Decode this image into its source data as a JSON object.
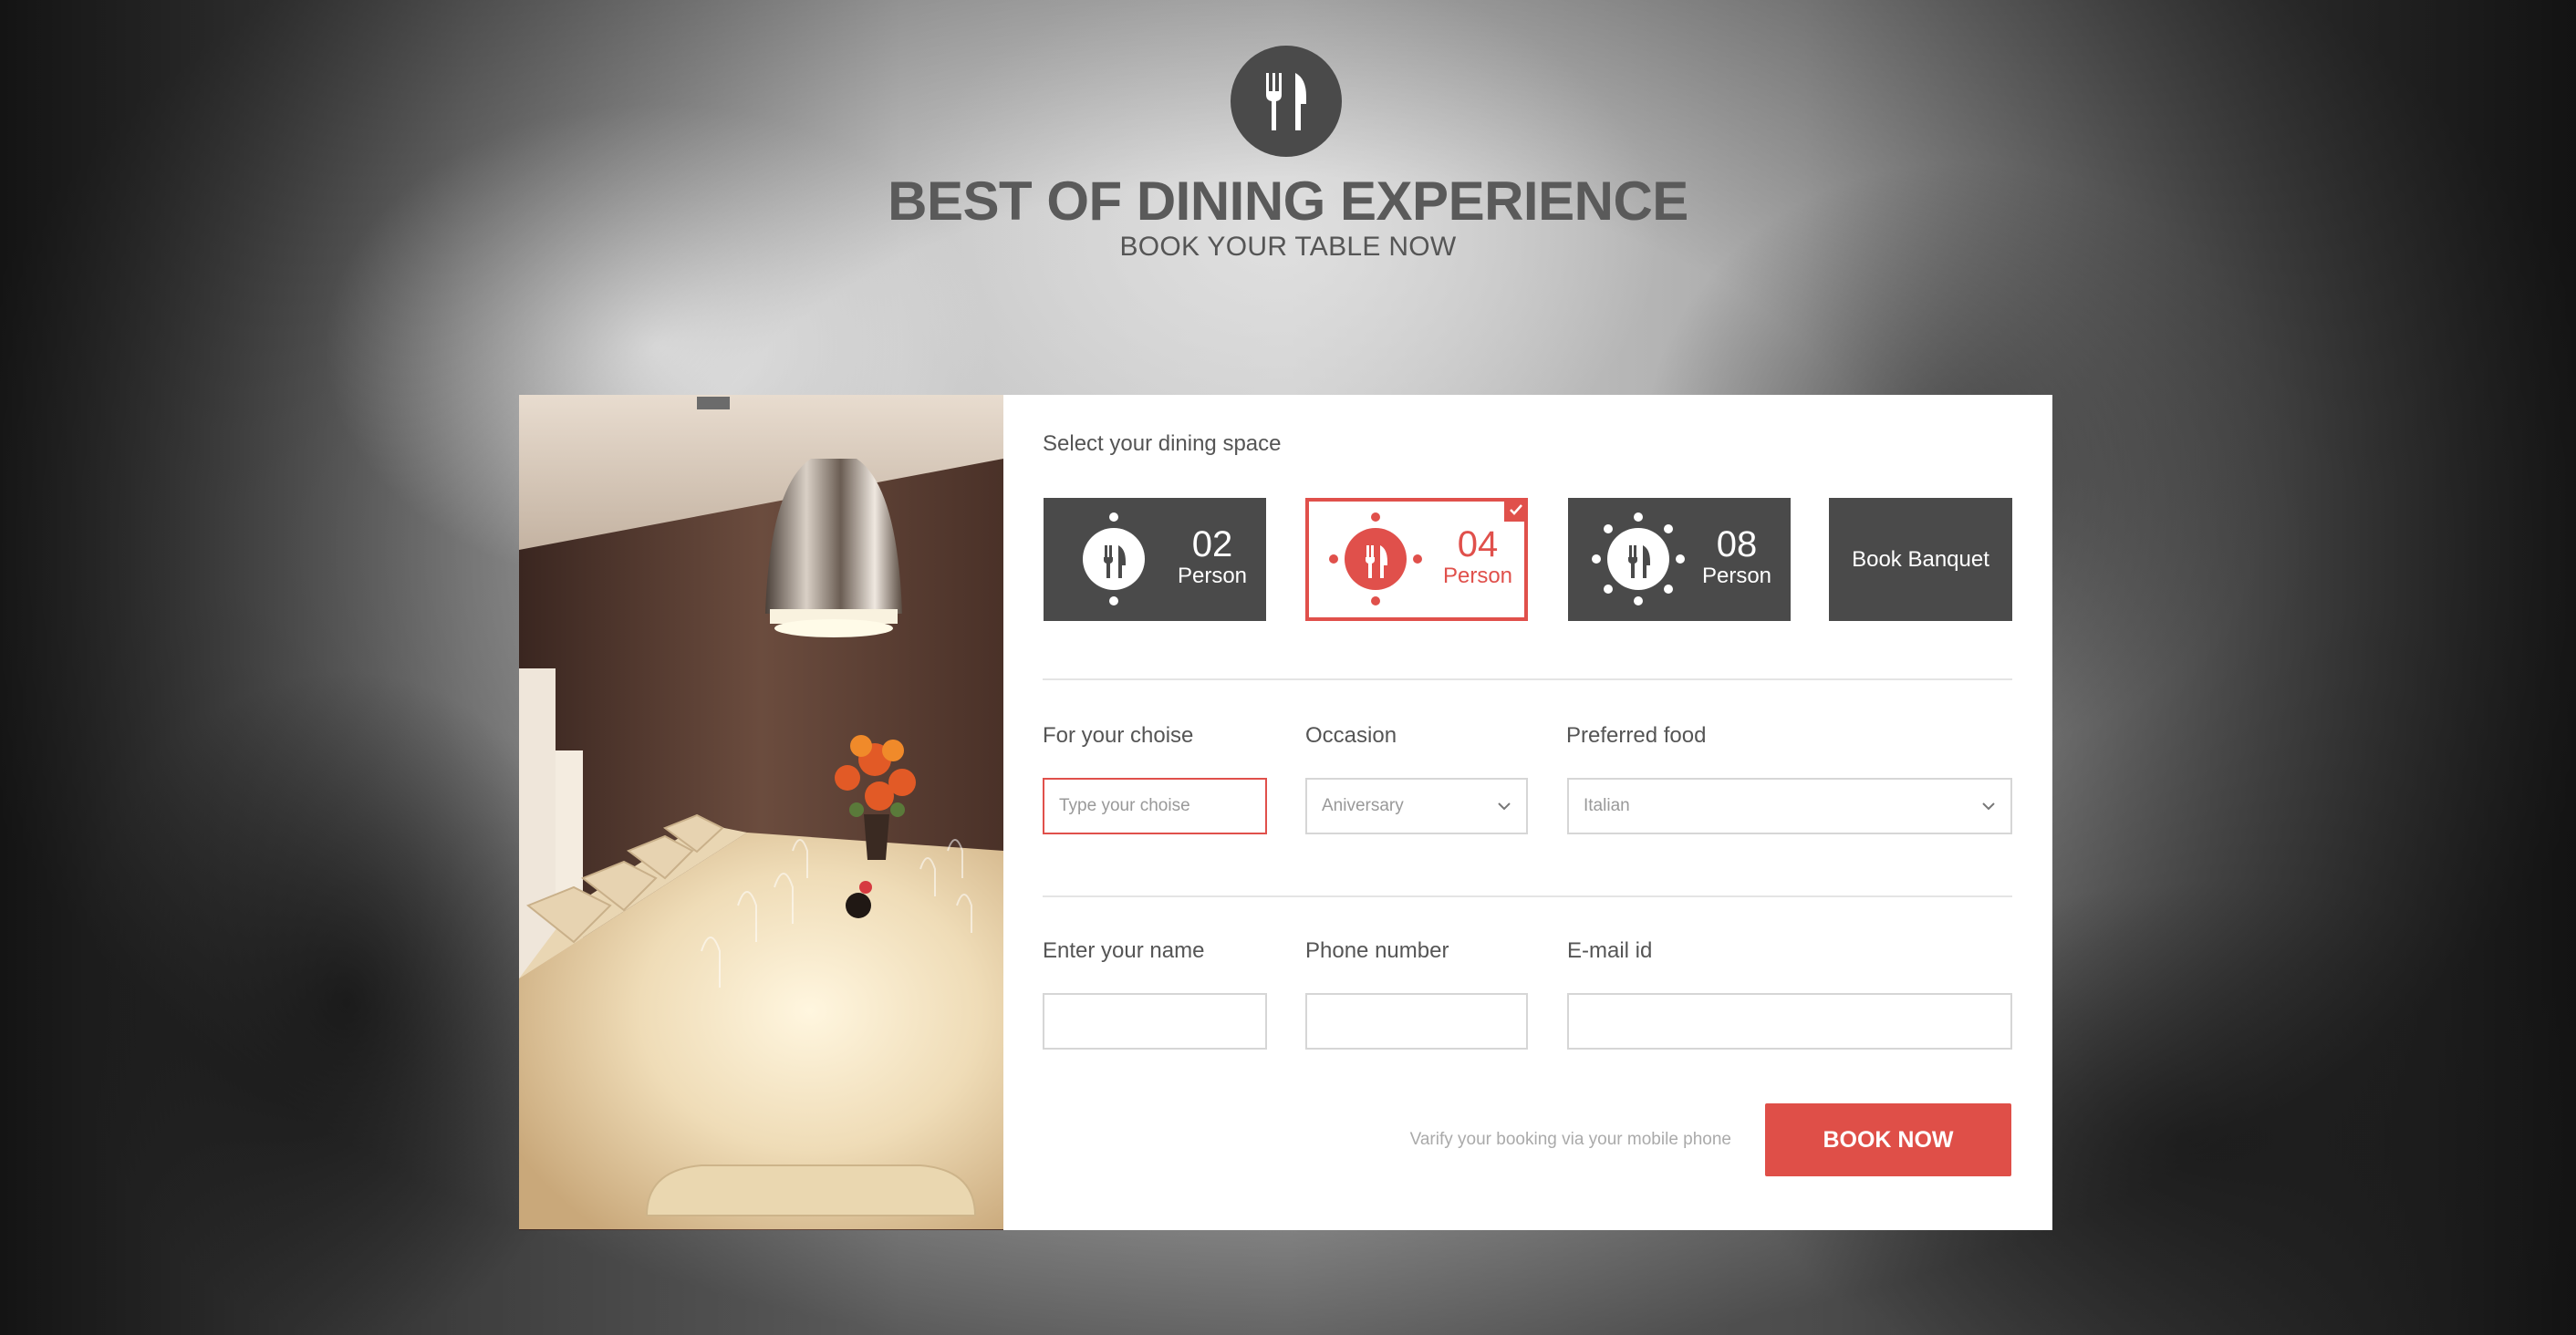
{
  "header": {
    "title": "BEST OF DINING EXPERIENCE",
    "subtitle": "BOOK YOUR TABLE NOW",
    "logo_icon": "fork-knife-icon"
  },
  "form": {
    "space_label": "Select your dining space",
    "options": [
      {
        "num": "02",
        "unit": "Person",
        "selected": false
      },
      {
        "num": "04",
        "unit": "Person",
        "selected": true
      },
      {
        "num": "08",
        "unit": "Person",
        "selected": false
      },
      {
        "label": "Book Banquet",
        "selected": false
      }
    ],
    "choice_label": "For your choise",
    "choice_placeholder": "Type your choise",
    "occasion_label": "Occasion",
    "occasion_value": "Aniversary",
    "food_label": "Preferred food",
    "food_value": "Italian",
    "name_label": "Enter your name",
    "phone_label": "Phone number",
    "email_label": "E-mail id",
    "verify_text": "Varify your booking via your mobile phone",
    "submit_label": "BOOK NOW"
  },
  "colors": {
    "accent": "#df4f48",
    "dark": "#4a4a4a"
  }
}
